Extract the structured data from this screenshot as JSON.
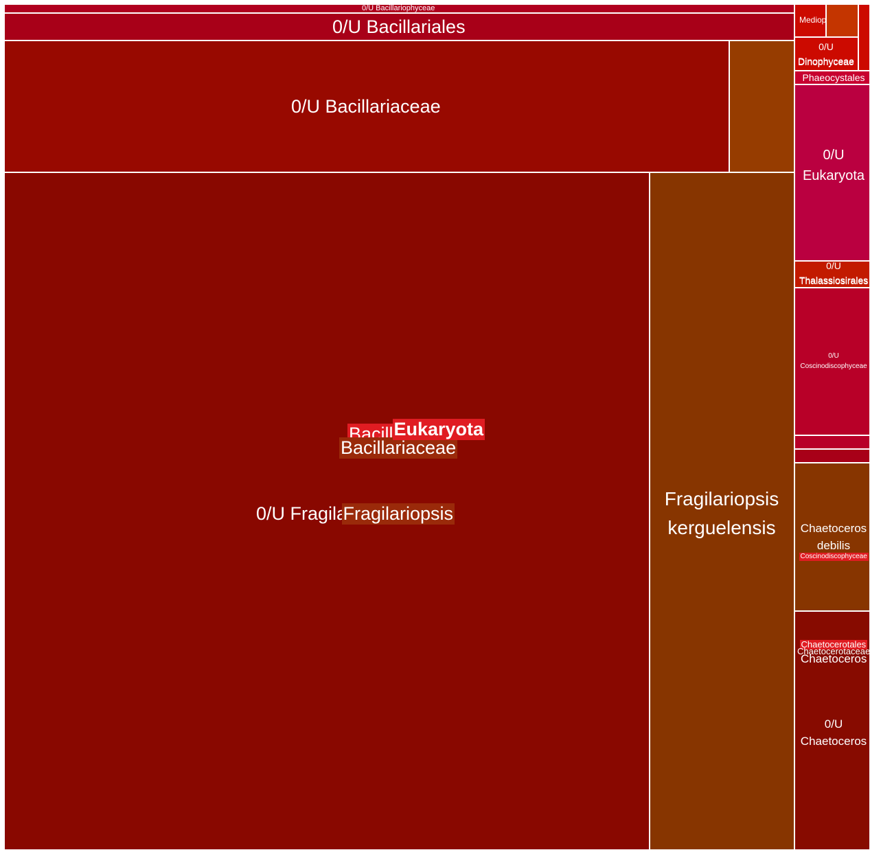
{
  "chart_data": {
    "type": "treemap",
    "colors": {
      "bacillariophyceae": "#b0001e",
      "bacillariales": "#a80018",
      "bacillariaceae": "#980900",
      "fragilariopsis_small": "#963c00",
      "fragilariopsis": "#890800",
      "kerguelensis": "#873500",
      "mediophyceae": "#cc0a00",
      "mediophyceae_sub": "#c43500",
      "dinophyceae": "#cc0a00",
      "phaeocystales": "#c80030",
      "eukaryota": "#ba0040",
      "thalassiosirales": "#c21a00",
      "coscinodiscophyceae": "#b80028",
      "debilis": "#873500",
      "chaetoceros": "#870b00",
      "highlight_red": "#e01c22",
      "highlight_brown": "#9a2a0a"
    },
    "nodes": [
      {
        "label": "0/U Bacillariophyceae",
        "color": "bacillariophyceae"
      },
      {
        "label": "0/U Bacillariales",
        "color": "bacillariales"
      },
      {
        "label": "0/U Bacillariaceae",
        "color": "bacillariaceae"
      },
      {
        "label": "",
        "color": "fragilariopsis_small"
      },
      {
        "label": "0/U Fragilariopsis",
        "color": "fragilariopsis"
      },
      {
        "label": "Fragilariopsis kerguelensis",
        "color": "kerguelensis"
      },
      {
        "label": "Mediophyceae",
        "color": "mediophyceae"
      },
      {
        "label": "",
        "color": "mediophyceae_sub"
      },
      {
        "label": "",
        "color": "mediophyceae"
      },
      {
        "label": "0/U Dinophyceae",
        "color": "dinophyceae"
      },
      {
        "label": "Phaeocystales",
        "color": "phaeocystales"
      },
      {
        "label": "0/U Eukaryota",
        "color": "eukaryota"
      },
      {
        "label": "0/U Thalassiosirales",
        "color": "thalassiosirales"
      },
      {
        "label": "0/U Coscinodiscophyceae",
        "color": "coscinodiscophyceae"
      },
      {
        "label": "",
        "color": "coscinodiscophyceae"
      },
      {
        "label": "",
        "color": "bacillariales"
      },
      {
        "label": "Chaetoceros debilis",
        "color": "debilis"
      },
      {
        "label": "0/U Chaetoceros",
        "color": "chaetoceros"
      }
    ],
    "overlay_labels": [
      {
        "text": "Bacillariales",
        "style": "red"
      },
      {
        "text": "Bacillariaceae",
        "style": "brown"
      },
      {
        "text": "Eukaryota",
        "style": "red-bold"
      },
      {
        "text": "Fragilariopsis",
        "style": "brown"
      },
      {
        "text": "Dinophyceae",
        "style": "plain"
      },
      {
        "text": "Thalassiosirales",
        "style": "plain"
      },
      {
        "text": "Coscinodiscophyceae",
        "style": "red"
      },
      {
        "text": "Chaetocerotales",
        "style": "red"
      },
      {
        "text": "Chaetocerotaceae",
        "style": "plain"
      },
      {
        "text": "Chaetoceros",
        "style": "plain"
      }
    ]
  }
}
